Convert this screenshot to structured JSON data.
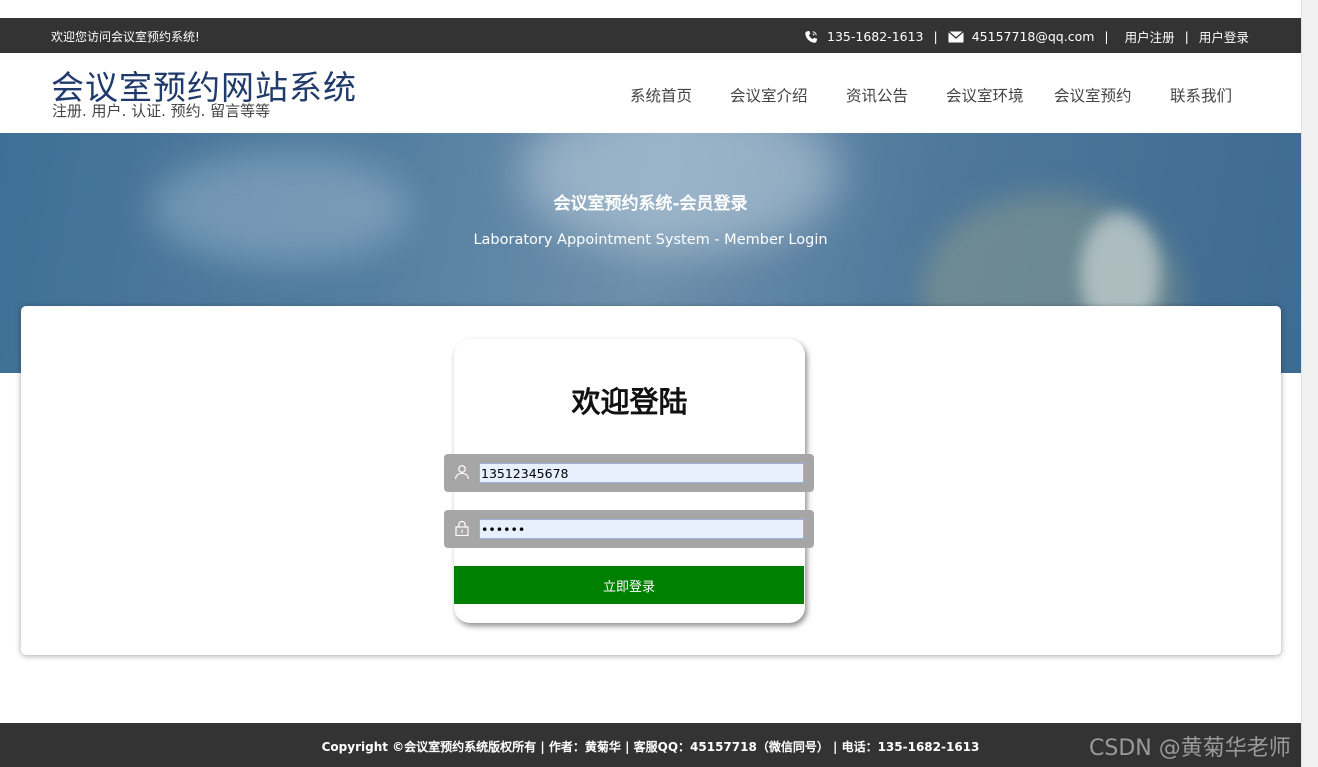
{
  "topbar": {
    "welcome": "欢迎您访问会议室预约系统!",
    "phone": "135-1682-1613",
    "email": "45157718@qq.com",
    "separator": "|",
    "register": "用户注册",
    "login": "用户登录",
    "phone_icon": "phone-icon",
    "email_icon": "mail-icon"
  },
  "header": {
    "title": "会议室预约网站系统",
    "subtitle": "注册. 用户. 认证. 预约. 留言等等"
  },
  "nav": {
    "items": [
      "系统首页",
      "会议室介绍",
      "资讯公告",
      "会议室环境",
      "会议室预约",
      "联系我们"
    ]
  },
  "banner": {
    "title": "会议室预约系统-会员登录",
    "subtitle": "Laboratory Appointment System - Member Login"
  },
  "login": {
    "heading": "欢迎登陆",
    "username": {
      "value": "13512345678",
      "icon": "user-icon"
    },
    "password": {
      "value": "123456",
      "icon": "lock-icon"
    },
    "submit_label": "立即登录"
  },
  "footer": {
    "copyright": "Copyright ©会议室预约系统版权所有 | 作者：黄菊华 | 客服QQ：45157718（微信同号） | 电话：135-1682-1613"
  },
  "watermark": "CSDN @黄菊华老师",
  "colors": {
    "topbar_bg": "#333333",
    "brand_title": "#1f3a6b",
    "login_button": "#008000",
    "input_wrap": "#a6a6a6",
    "input_bg": "#e8f0fe"
  }
}
